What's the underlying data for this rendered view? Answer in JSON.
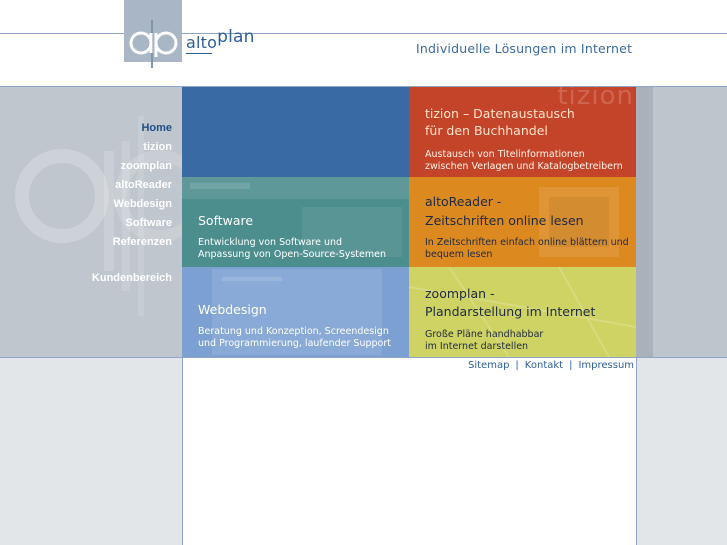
{
  "header": {
    "brand_part1": "alto",
    "brand_part2": "plan",
    "tagline": "Individuelle Lösungen im Internet"
  },
  "nav": {
    "items": [
      {
        "label": "Home",
        "active": true
      },
      {
        "label": "tizion"
      },
      {
        "label": "zoomplan"
      },
      {
        "label": "altoReader"
      },
      {
        "label": "Webdesign"
      },
      {
        "label": "Software"
      },
      {
        "label": "Referenzen"
      },
      {
        "label": "Kundenbereich"
      }
    ]
  },
  "tiles": {
    "tizion": {
      "watermark": "tizion",
      "title_line1": "tizion – Datenaustausch",
      "title_line2": "für den Buchhandel",
      "desc_line1": "Austausch von Titelinformationen",
      "desc_line2": "zwischen Verlagen und Katalogbetreibern"
    },
    "software": {
      "title": "Software",
      "desc_line1": "Entwicklung von Software und",
      "desc_line2": "Anpassung von Open-Source-Systemen"
    },
    "altoreader": {
      "title_line1": "altoReader -",
      "title_line2": "Zeitschriften online lesen",
      "desc_line1": "In Zeitschriften einfach online blättern und",
      "desc_line2": "bequem lesen"
    },
    "webdesign": {
      "title": "Webdesign",
      "desc_line1": "Beratung und Konzeption, Screendesign",
      "desc_line2": "und Programmierung, laufender Support"
    },
    "zoomplan": {
      "title_line1": "zoomplan -",
      "title_line2": "Plandarstellung im Internet",
      "desc_line1": "Große Pläne handhabbar",
      "desc_line2": "im Internet darstellen"
    }
  },
  "footer": {
    "sitemap": "Sitemap",
    "kontakt": "Kontakt",
    "impressum": "Impressum",
    "separator": "|"
  }
}
